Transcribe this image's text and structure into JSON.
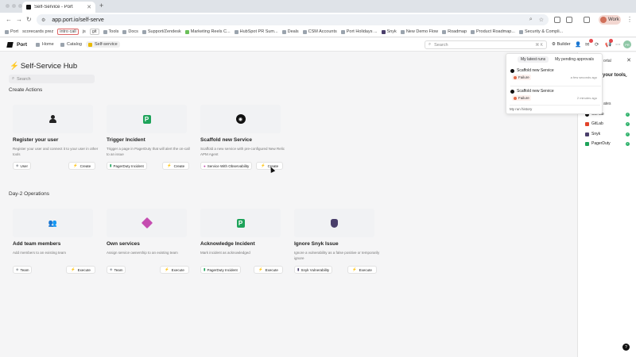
{
  "browser": {
    "tab_title": "Self-Service - Port",
    "url": "app.port.io/self-serve",
    "profile_label": "Work",
    "bookmarks": [
      "Port",
      "scorecards prez",
      "intro call",
      "js",
      "git",
      "Tools",
      "Docs",
      "Support/Zendesk",
      "Marketing Reels C...",
      "HubSpot PR Sum...",
      "Deals",
      "CSM Accounts",
      "Port Holidays ...",
      "Snyk",
      "New Demo Flow",
      "Roadmap",
      "Product Roadmap...",
      "Security & Compli..."
    ]
  },
  "header": {
    "brand": "Port",
    "nav": [
      "Home",
      "Catalog",
      "Self-service"
    ],
    "search_placeholder": "Search",
    "search_shortcut": "⌘ K",
    "builder_label": "Builder",
    "avatar_initials": "PR",
    "notification_count": "1"
  },
  "hub": {
    "title": "Self-Service Hub",
    "search_placeholder": "Search"
  },
  "sections": {
    "create": "Create Actions",
    "day2": "Day-2 Operations"
  },
  "create_actions": [
    {
      "title": "Register your user",
      "desc": "Register your user and connect it to your user in other tools",
      "chip": "User",
      "button": "Create"
    },
    {
      "title": "Trigger Incident",
      "desc": "Trigger a page in PagerDuty that will alert the on-call to an issue",
      "chip": "PagerDuty Incident",
      "button": "Create"
    },
    {
      "title": "Scaffold new Service",
      "desc": "Scaffold a new service with pre-configured New Relic APM Agent",
      "chip": "Service With Observability",
      "button": "Create"
    }
  ],
  "day2_actions": [
    {
      "title": "Add team members",
      "desc": "Add members to an existing team",
      "chip": "Team",
      "button": "Execute"
    },
    {
      "title": "Own services",
      "desc": "Assign service ownership to an existing team",
      "chip": "Team",
      "button": "Execute"
    },
    {
      "title": "Acknowledge Incident",
      "desc": "Mark incident as acknowledged",
      "chip": "PagerDuty Incident",
      "button": "Execute"
    },
    {
      "title": "Ignore Snyk Issue",
      "desc": "Ignore a vulnerability as a false positive or temporarily ignore",
      "chip": "Snyk Vulnerability",
      "button": "Execute"
    }
  ],
  "runs_popover": {
    "tabs": [
      "My latest runs",
      "My pending approvals"
    ],
    "runs": [
      {
        "title": "Scaffold new Service",
        "status": "Failure",
        "time": "a few seconds ago"
      },
      {
        "title": "Scaffold new Service",
        "status": "Failure",
        "time": "2 minutes ago"
      }
    ],
    "history_link": "My run history"
  },
  "side_panel": {
    "portal_label": "ortal",
    "tools_label": "your tools",
    "updates_label": "ates",
    "items": [
      "GitHub",
      "GitLab",
      "Snyk",
      "PagerDuty"
    ]
  },
  "colors": {
    "accent_bolt": "#e8b900",
    "success": "#2fb26b",
    "failure": "#e26b4a",
    "pagerduty": "#1ea35a"
  }
}
